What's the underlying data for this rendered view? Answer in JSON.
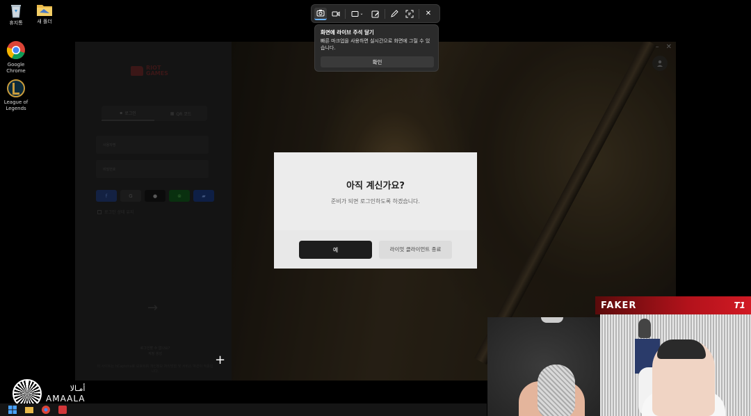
{
  "desktop": {
    "icons": [
      {
        "label": "휴지통"
      },
      {
        "label": "새 폴더"
      },
      {
        "label": "Google Chrome"
      },
      {
        "label": "League of Legends"
      }
    ]
  },
  "client": {
    "brand_line1": "RIOT",
    "brand_line2": "GAMES",
    "tab_login": "로그인",
    "tab_qr": "QR 코드",
    "username_placeholder": "사용자명",
    "password_placeholder": "비밀번호",
    "remember_label": "로그인 상태 유지",
    "submit_arrow": "→",
    "link_trouble": "로그인할 수 없나요?",
    "link_create": "계정 생성",
    "legal": "이 사이트는 hCaptcha로 보호되며 개인정보 처리방침 및 서비스 약관이 적용됩니다."
  },
  "modal": {
    "title": "아직 계신가요?",
    "message": "준비가 되면 로그인하도록 하겠습니다.",
    "yes_label": "예",
    "quit_label": "라이엇 클라이언트 종료"
  },
  "snip": {
    "tooltip_title": "화면에 라이브 주석 달기",
    "tooltip_body": "빠른 마크업을 사용하면 실시간으로 화면에 그릴 수 있습니다.",
    "ok_label": "확인"
  },
  "overlay": {
    "sponsor_arabic": "أمـالا",
    "sponsor_latin": "AMAALA",
    "streamer_name": "FAKER",
    "team_logo": "T1"
  },
  "colors": {
    "banner_red": "#b3121b",
    "modal_bg": "#ececec",
    "primary_button": "#1d1d1d"
  }
}
